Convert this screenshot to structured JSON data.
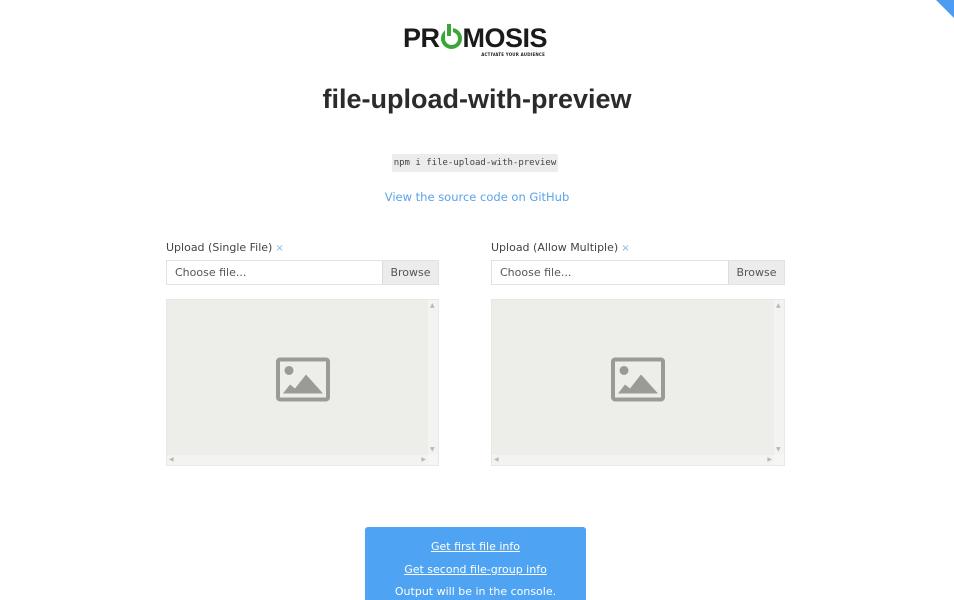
{
  "brand": {
    "logo_text_before": "PR",
    "logo_text_after": "MOSIS",
    "tagline": "ACTIVATE YOUR AUDIENCE",
    "logo_accent_color": "#3aa63a"
  },
  "header": {
    "title": "file-upload-with-preview",
    "install_command": "npm i file-upload-with-preview",
    "source_link": "View the source code on GitHub"
  },
  "uploads": [
    {
      "label": "Upload (Single File)",
      "required_mark": "×",
      "placeholder": "Choose file...",
      "browse_label": "Browse",
      "preview_icon": "image-placeholder-icon"
    },
    {
      "label": "Upload (Allow Multiple)",
      "required_mark": "×",
      "placeholder": "Choose file...",
      "browse_label": "Browse",
      "preview_icon": "image-placeholder-icon"
    }
  ],
  "actions": {
    "first_file_info": "Get first file info",
    "second_group_info": "Get second file-group info",
    "note": "Output will be in the console.",
    "background_color": "#4fa3f3"
  },
  "colors": {
    "link": "#5aa4e8",
    "corner_ribbon": "#4a9df0"
  }
}
